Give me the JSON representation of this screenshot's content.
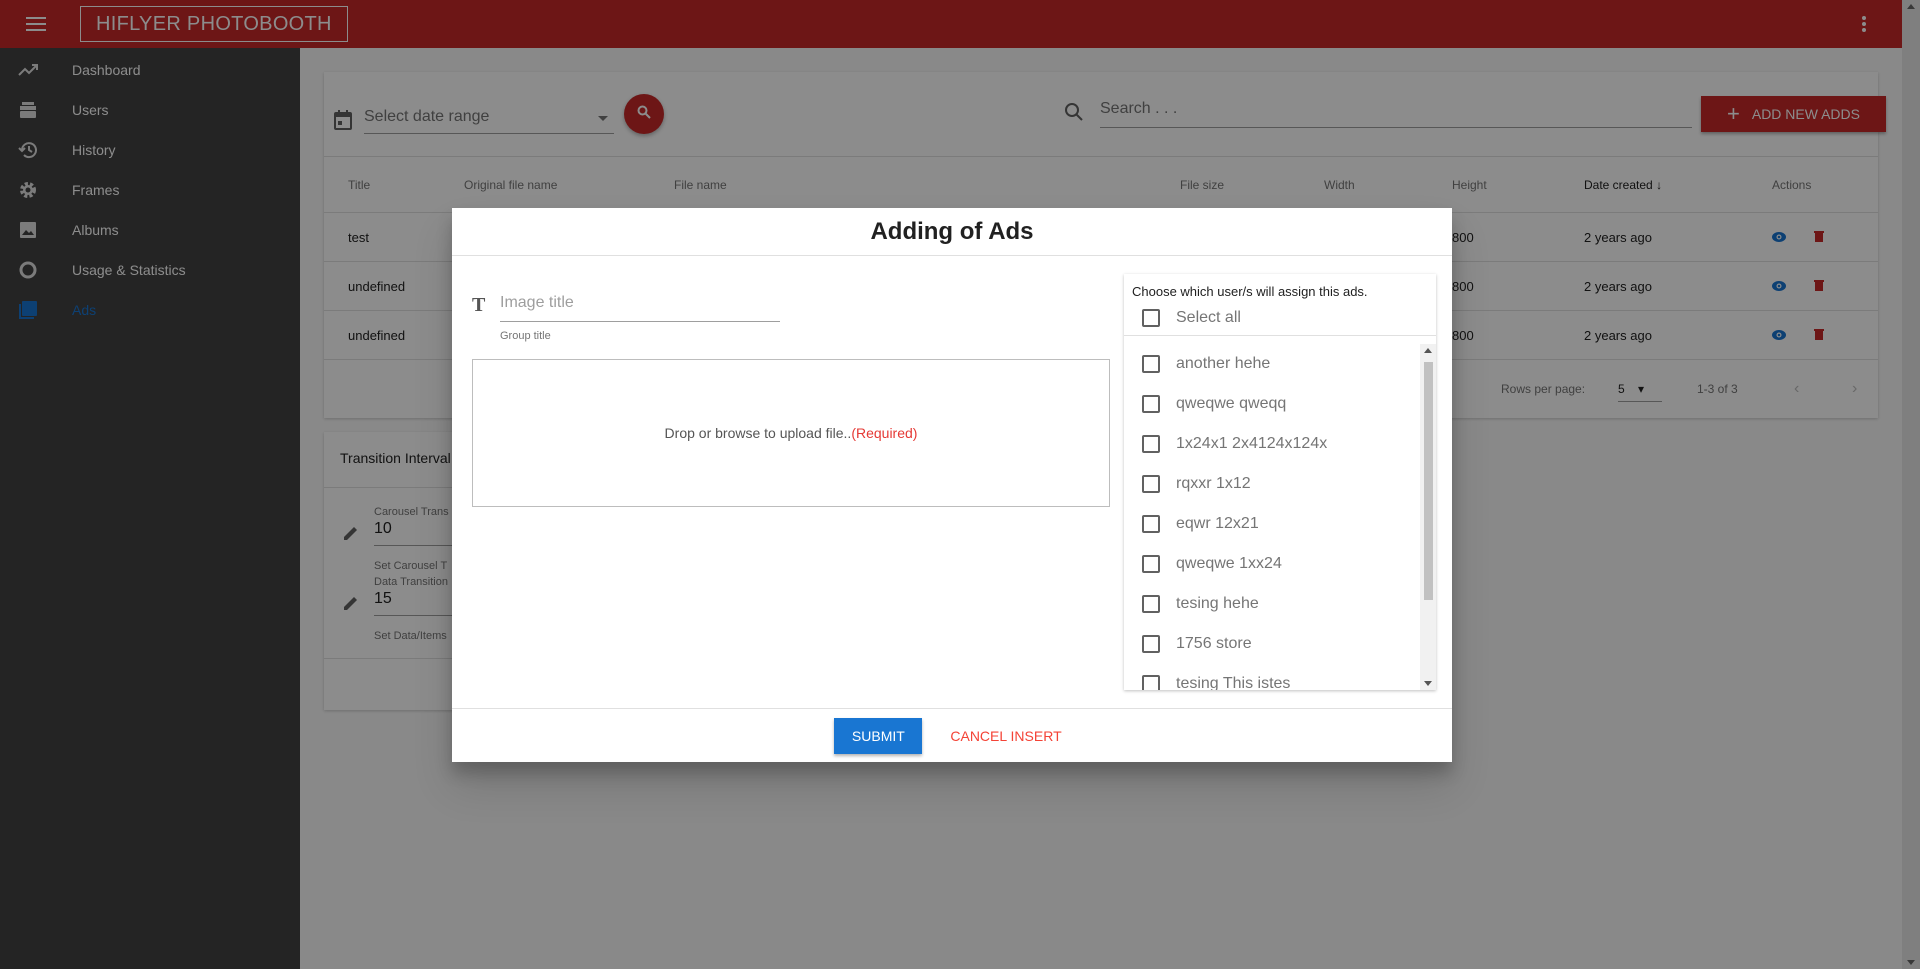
{
  "app": {
    "brand": "HIFLYER PHOTOBOOTH"
  },
  "sidebar": {
    "items": [
      {
        "label": "Dashboard",
        "icon": "trending-up-icon"
      },
      {
        "label": "Users",
        "icon": "users-icon"
      },
      {
        "label": "History",
        "icon": "history-icon"
      },
      {
        "label": "Frames",
        "icon": "gear-icon"
      },
      {
        "label": "Albums",
        "icon": "image-icon"
      },
      {
        "label": "Usage & Statistics",
        "icon": "circle-icon"
      },
      {
        "label": "Ads",
        "icon": "ads-icon",
        "active": true
      }
    ]
  },
  "toolbar": {
    "date_placeholder": "Select date range",
    "search_placeholder": "Search . . .",
    "add_label": "ADD NEW ADDS"
  },
  "table": {
    "columns": [
      "Title",
      "Original file name",
      "File name",
      "File size",
      "Width",
      "Height",
      "Date created",
      "Actions"
    ],
    "rows": [
      {
        "title": "test",
        "height": "800",
        "date": "2 years ago"
      },
      {
        "title": "undefined",
        "height": "800",
        "date": "2 years ago"
      },
      {
        "title": "undefined",
        "height": "800",
        "date": "2 years ago"
      }
    ],
    "rows_per_page_label": "Rows per page:",
    "rows_per_page": "5",
    "range": "1-3 of 3"
  },
  "transition": {
    "header": "Transition Interval",
    "carousel_label": "Carousel Trans",
    "carousel_value": "10",
    "carousel_hint": "Set Carousel T",
    "data_label": "Data Transition",
    "data_value": "15",
    "data_hint": "Set Data/Items"
  },
  "dialog": {
    "title": "Adding of Ads",
    "image_title_placeholder": "Image title",
    "group_hint": "Group title",
    "dropzone_text": "Drop or browse to upload file..",
    "dropzone_required": "(Required)",
    "users_heading": "Choose which user/s will assign this ads.",
    "select_all": "Select all",
    "users": [
      "another hehe",
      "qweqwe qweqq",
      "1x24x1 2x4124x124x",
      "rqxxr 1x12",
      "eqwr 12x21",
      "qweqwe 1xx24",
      "tesing hehe",
      "1756 store",
      "tesing This istes"
    ],
    "submit_label": "SUBMIT",
    "cancel_label": "CANCEL INSERT"
  },
  "colors": {
    "primary": "#c62828",
    "accent": "#1976d2",
    "sidebar": "#424242"
  }
}
